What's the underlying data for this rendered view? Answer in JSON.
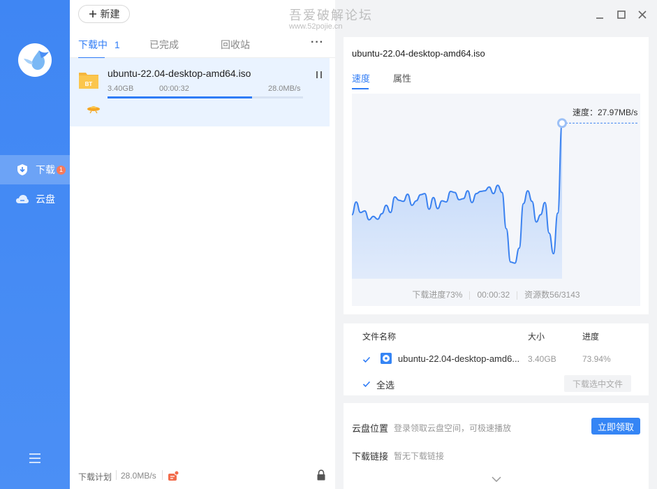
{
  "sidebar": {
    "nav": [
      {
        "label": "下载",
        "badge": "1",
        "icon": "download-shield-icon",
        "active": true
      },
      {
        "label": "云盘",
        "icon": "cloud-icon",
        "active": false
      }
    ]
  },
  "toolbar": {
    "new_label": "新建"
  },
  "watermark": {
    "line1": "吾爱破解论坛",
    "line2": "www.52pojie.cn"
  },
  "list_tabs": [
    {
      "label": "下载中",
      "count": "1",
      "active": true
    },
    {
      "label": "已完成",
      "active": false
    },
    {
      "label": "回收站",
      "active": false
    }
  ],
  "task": {
    "name": "ubuntu-22.04-desktop-amd64.iso",
    "size": "3.40GB",
    "elapsed": "00:00:32",
    "speed": "28.0MB/s",
    "progress": 0.74,
    "icon_label": "BT"
  },
  "bottombar": {
    "plan_label": "下载计划",
    "speed": "28.0MB/s"
  },
  "detail": {
    "filename": "ubuntu-22.04-desktop-amd64.iso",
    "tabs": [
      {
        "label": "速度",
        "active": true
      },
      {
        "label": "属性",
        "active": false
      }
    ],
    "speed_label": "速度：27.97MB/s",
    "stats": [
      "下载进度73%",
      "00:00:32",
      "资源数56/3143"
    ]
  },
  "chart_data": {
    "type": "area",
    "title": "",
    "xlabel": "",
    "ylabel": "",
    "ylim": [
      0,
      28
    ],
    "series": [
      {
        "values": [
          11.5,
          13.8,
          11.9,
          12.2,
          10.6,
          11.2,
          10.7,
          11.7,
          13.2,
          11.9,
          14.7,
          14.1,
          13.9,
          15.2,
          13.2,
          14.0,
          15.1,
          15.3,
          12.5,
          14.6,
          12.6,
          14.0,
          13.8,
          15.7,
          15.5,
          14.2,
          14.4,
          15.8,
          13.7,
          15.3,
          15.7,
          15.8,
          16.5,
          15.3,
          16.8,
          15.5,
          9.0,
          3.0,
          2.8,
          5.5,
          13.5,
          15.8,
          13.9,
          10.2,
          11.5,
          13.7,
          8.2,
          4.5,
          11.8,
          27.97
        ]
      }
    ]
  },
  "files": {
    "col_name": "文件名称",
    "col_size": "大小",
    "col_progress": "进度",
    "rows": [
      {
        "name": "ubuntu-22.04-desktop-amd6...",
        "size": "3.40GB",
        "progress": "73.94%",
        "checked": true
      }
    ],
    "select_all": "全选",
    "download_selected": "下载选中文件"
  },
  "cloud": {
    "pos_label": "云盘位置",
    "pos_hint": "登录领取云盘空间，可极速播放",
    "claim_label": "立即领取",
    "link_label": "下载链接",
    "link_hint": "暂无下载链接"
  },
  "colors": {
    "accent": "#2f7cf6",
    "sidebar": "#4389f4",
    "badge": "#f77a5b"
  }
}
